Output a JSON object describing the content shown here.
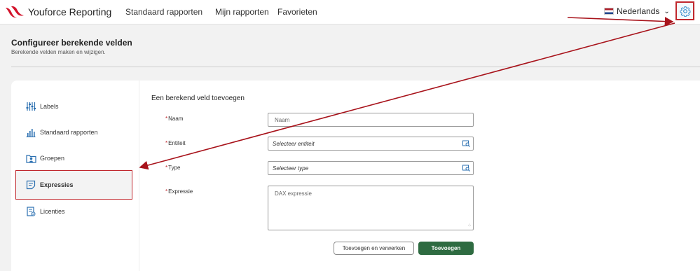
{
  "app": {
    "brand": "Youforce Reporting"
  },
  "nav": {
    "items": [
      "Standaard rapporten",
      "Mijn rapporten",
      "Favorieten"
    ]
  },
  "language": {
    "selected": "Nederlands"
  },
  "icons": {
    "settings": "gear-icon",
    "language_toggle": "chevron-down-icon"
  },
  "page": {
    "title": "Configureer berekende velden",
    "subtitle": "Berekende velden maken en wijzigen."
  },
  "sidebar": {
    "items": [
      {
        "label": "Labels",
        "icon": "sliders-icon"
      },
      {
        "label": "Standaard rapporten",
        "icon": "bar-chart-icon"
      },
      {
        "label": "Groepen",
        "icon": "folder-user-icon"
      },
      {
        "label": "Expressies",
        "icon": "note-icon",
        "active": true
      },
      {
        "label": "Licenties",
        "icon": "license-icon"
      }
    ]
  },
  "form": {
    "title": "Een berekend veld toevoegen",
    "required_marker": "*",
    "fields": {
      "naam": {
        "label": "Naam",
        "placeholder": "Naam"
      },
      "entiteit": {
        "label": "Entiteit",
        "placeholder": "Selecteer entiteit"
      },
      "type": {
        "label": "Type",
        "placeholder": "Selecteer type"
      },
      "expressie": {
        "label": "Expressie",
        "placeholder": "DAX expressie"
      }
    },
    "buttons": {
      "secondary": "Toevoegen en verwerken",
      "primary": "Toevoegen"
    }
  },
  "colors": {
    "accent_red": "#c0272d",
    "primary_green": "#2e6b41",
    "brand_red": "#d3132b"
  }
}
